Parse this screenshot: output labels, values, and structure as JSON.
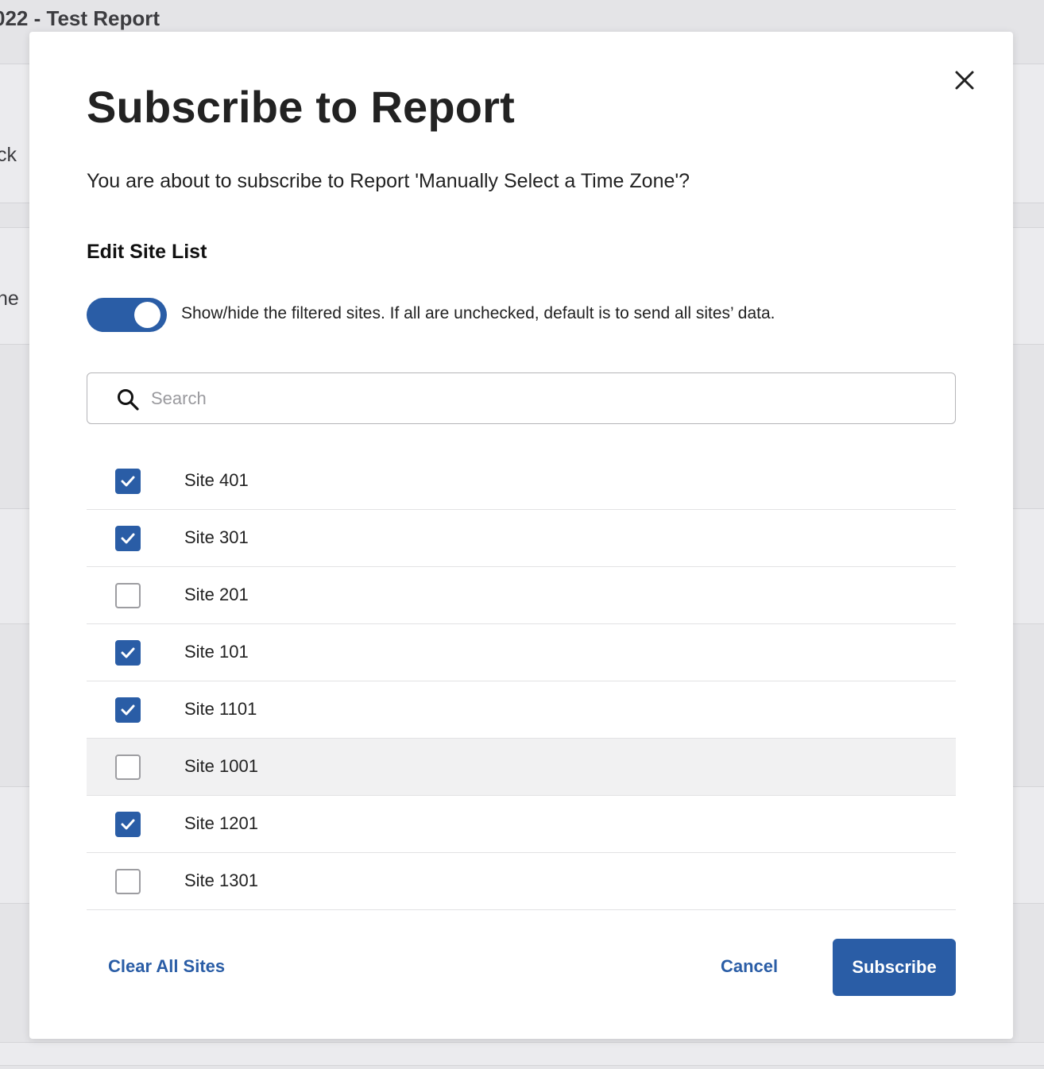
{
  "background": {
    "title": "022 - Test Report",
    "snippets": [
      "ck",
      "ne"
    ]
  },
  "modal": {
    "title": "Subscribe to Report",
    "description": "You are about to subscribe to Report 'Manually Select a Time Zone'?",
    "section_title": "Edit Site List",
    "toggle": {
      "on": true,
      "label": "Show/hide the filtered sites. If all are unchecked, default is to send all sites’ data."
    },
    "search": {
      "placeholder": "Search",
      "value": ""
    },
    "sites": [
      {
        "label": "Site 401",
        "checked": true
      },
      {
        "label": "Site 301",
        "checked": true
      },
      {
        "label": "Site 201",
        "checked": false
      },
      {
        "label": "Site 101",
        "checked": true
      },
      {
        "label": "Site 1101",
        "checked": true
      },
      {
        "label": "Site 1001",
        "checked": false,
        "hovered": true
      },
      {
        "label": "Site 1201",
        "checked": true
      },
      {
        "label": "Site 1301",
        "checked": false
      }
    ],
    "footer": {
      "clear_label": "Clear All Sites",
      "cancel_label": "Cancel",
      "subscribe_label": "Subscribe"
    }
  },
  "colors": {
    "accent": "#2a5da6",
    "overlay": "#e4e4e7",
    "hover_row": "#f1f1f2"
  }
}
